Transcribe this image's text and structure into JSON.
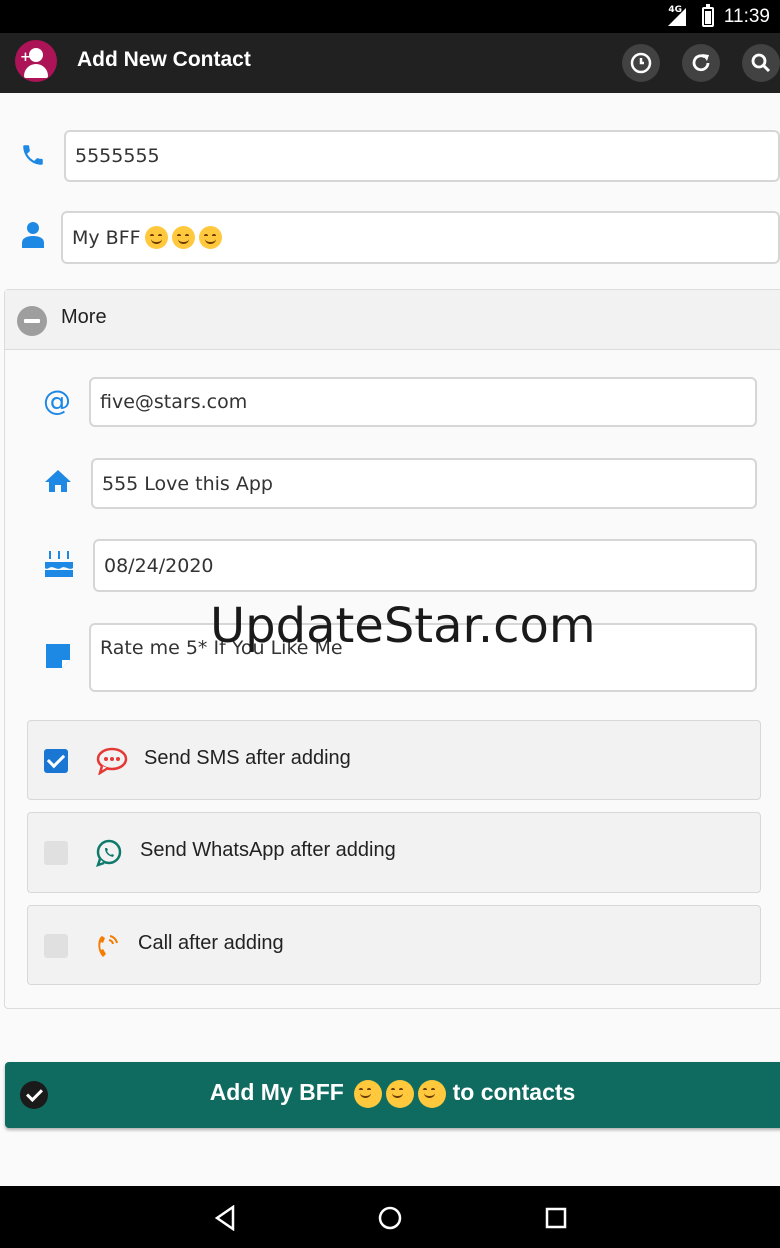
{
  "status_bar": {
    "network": "4G",
    "time": "11:39"
  },
  "toolbar": {
    "title": "Add New Contact",
    "actions": [
      "history-icon",
      "refresh-icon",
      "search-icon"
    ]
  },
  "contact": {
    "phone": "5555555",
    "name": "My BFF"
  },
  "more": {
    "label": "More",
    "email": "five@stars.com",
    "address": "555 Love this App",
    "birthday": "08/24/2020",
    "note": "Rate me 5* If You Like Me"
  },
  "options": [
    {
      "label": "Send SMS after adding",
      "checked": true,
      "icon": "sms-icon",
      "color": "#e53935"
    },
    {
      "label": "Send WhatsApp after adding",
      "checked": false,
      "icon": "whatsapp-icon",
      "color": "#0f7a6c"
    },
    {
      "label": "Call after adding",
      "checked": false,
      "icon": "call-icon",
      "color": "#f57c00"
    }
  ],
  "add_button": {
    "prefix": "Add My BFF",
    "suffix": "to contacts"
  },
  "watermark": "UpdateStar.com",
  "colors": {
    "accent": "#1e88e5",
    "primary": "#0f6b5f",
    "toolbar": "#212121"
  }
}
